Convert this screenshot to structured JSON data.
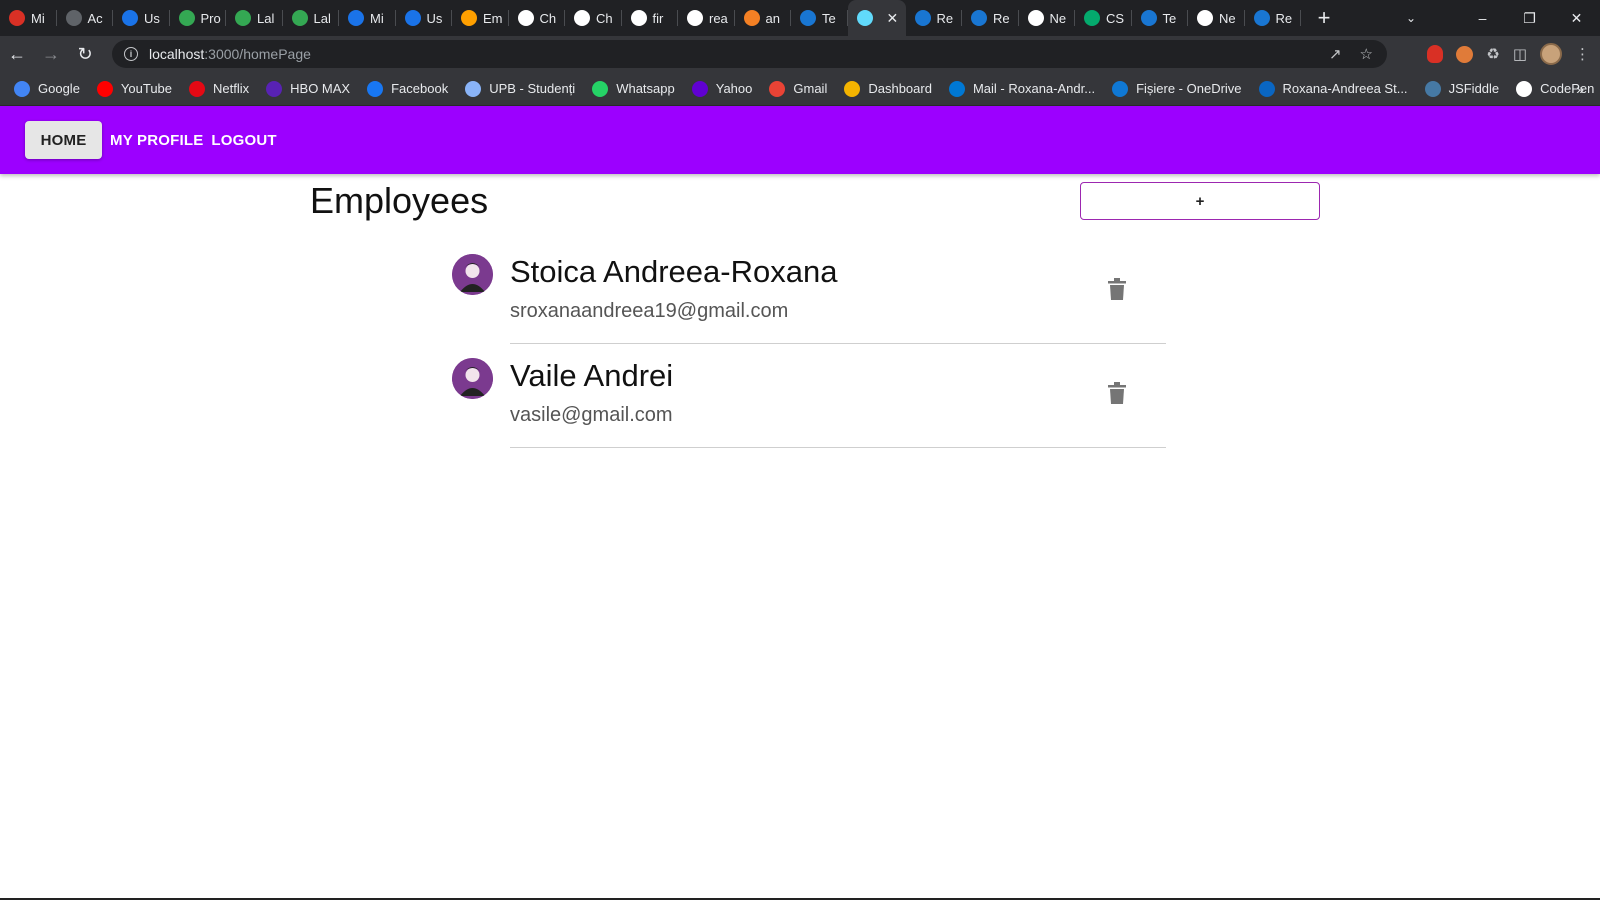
{
  "browser": {
    "tabs": [
      {
        "label": "Mi",
        "icon": "gmail-icon",
        "color": "#d93025"
      },
      {
        "label": "Ac",
        "icon": "globe-icon",
        "color": "#5f6368"
      },
      {
        "label": "Us",
        "icon": "code-icon",
        "color": "#1a73e8"
      },
      {
        "label": "Pro",
        "icon": "document-icon",
        "color": "#34a853"
      },
      {
        "label": "Lal",
        "icon": "document-icon",
        "color": "#34a853"
      },
      {
        "label": "Lal",
        "icon": "document-icon",
        "color": "#34a853"
      },
      {
        "label": "Mi",
        "icon": "grid-icon",
        "color": "#1a73e8"
      },
      {
        "label": "Us",
        "icon": "code-icon",
        "color": "#1a73e8"
      },
      {
        "label": "Em",
        "icon": "firebase-icon",
        "color": "#ffa000"
      },
      {
        "label": "Ch",
        "icon": "medium-icon",
        "color": "#ffffff"
      },
      {
        "label": "Ch",
        "icon": "medium-icon",
        "color": "#ffffff"
      },
      {
        "label": "fir",
        "icon": "google-icon",
        "color": "#ffffff"
      },
      {
        "label": "rea",
        "icon": "google-icon",
        "color": "#ffffff"
      },
      {
        "label": "an",
        "icon": "stackoverflow-icon",
        "color": "#f48024"
      },
      {
        "label": "Te",
        "icon": "mui-icon",
        "color": "#1976d2"
      },
      {
        "label": "",
        "icon": "react-icon",
        "color": "#61dafb",
        "active": true
      },
      {
        "label": "Re",
        "icon": "mui-icon",
        "color": "#1976d2"
      },
      {
        "label": "Re",
        "icon": "mui-icon",
        "color": "#1976d2"
      },
      {
        "label": "Ne",
        "icon": "github-icon",
        "color": "#ffffff"
      },
      {
        "label": "CS",
        "icon": "w3schools-icon",
        "color": "#04aa6d"
      },
      {
        "label": "Te",
        "icon": "mui-icon",
        "color": "#1976d2"
      },
      {
        "label": "Ne",
        "icon": "github-icon",
        "color": "#ffffff"
      },
      {
        "label": "Re",
        "icon": "mui-icon",
        "color": "#1976d2"
      }
    ],
    "new_tab_symbol": "+",
    "url_host": "localhost",
    "url_path": ":3000/homePage",
    "bookmarks": [
      {
        "label": "Google",
        "icon": "google-icon",
        "color": "#4285f4"
      },
      {
        "label": "YouTube",
        "icon": "youtube-icon",
        "color": "#ff0000"
      },
      {
        "label": "Netflix",
        "icon": "netflix-icon",
        "color": "#e50914"
      },
      {
        "label": "HBO MAX",
        "icon": "hbomax-icon",
        "color": "#5822b4"
      },
      {
        "label": "Facebook",
        "icon": "facebook-icon",
        "color": "#1877f2"
      },
      {
        "label": "UPB - Studenți",
        "icon": "upb-icon",
        "color": "#8ab4f8"
      },
      {
        "label": "Whatsapp",
        "icon": "whatsapp-icon",
        "color": "#25d366"
      },
      {
        "label": "Yahoo",
        "icon": "yahoo-icon",
        "color": "#6001d2"
      },
      {
        "label": "Gmail",
        "icon": "gmail-icon",
        "color": "#ea4335"
      },
      {
        "label": "Dashboard",
        "icon": "dashboard-icon",
        "color": "#f4b400"
      },
      {
        "label": "Mail - Roxana-Andr...",
        "icon": "outlook-icon",
        "color": "#0078d4"
      },
      {
        "label": "Fișiere - OneDrive",
        "icon": "onedrive-icon",
        "color": "#0f78d4"
      },
      {
        "label": "Roxana-Andreea St...",
        "icon": "linkedin-icon",
        "color": "#0a66c2"
      },
      {
        "label": "JSFiddle",
        "icon": "jsfiddle-icon",
        "color": "#4679a4"
      },
      {
        "label": "CodePen",
        "icon": "codepen-icon",
        "color": "#ffffff"
      }
    ],
    "bookmarks_more": "»"
  },
  "app": {
    "nav": {
      "home": "HOME",
      "profile": "MY PROFILE",
      "logout": "LOGOUT"
    },
    "accent_color": "#9c00ff",
    "title": "Employees",
    "add_button": "+",
    "employees": [
      {
        "name": "Stoica Andreea-Roxana",
        "email": "sroxanaandreea19@gmail.com"
      },
      {
        "name": "Vaile Andrei",
        "email": "vasile@gmail.com"
      }
    ]
  }
}
